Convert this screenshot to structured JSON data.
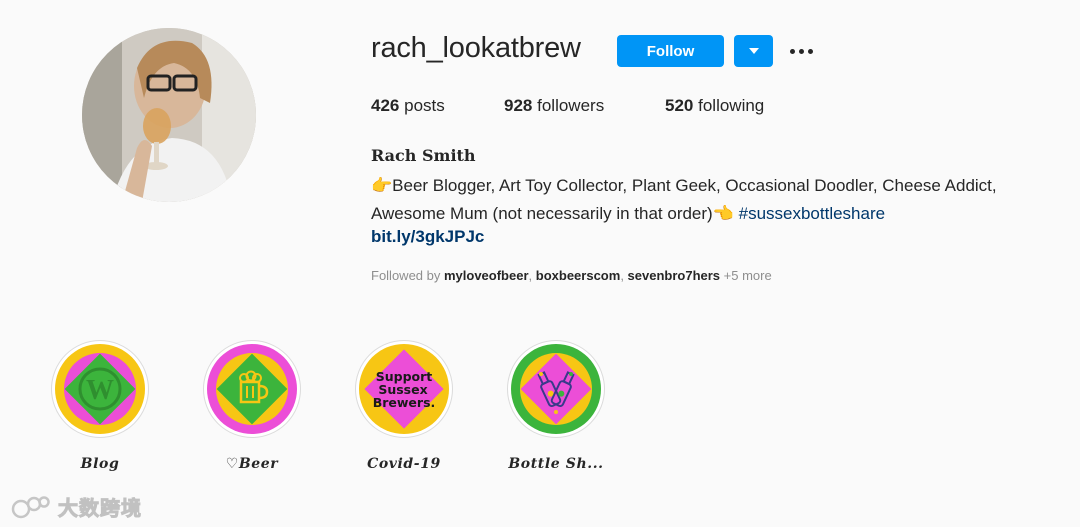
{
  "profile": {
    "username": "rach_lookatbrew",
    "follow_label": "Follow",
    "full_name": "Rach Smith",
    "stats": {
      "posts_count": "426",
      "posts_label": "posts",
      "followers_count": "928",
      "followers_label": "followers",
      "following_count": "520",
      "following_label": "following"
    },
    "bio": {
      "line1": "👉Beer Blogger, Art Toy Collector, Plant Geek, Occasional Doodler, Cheese Addict,",
      "line2": "Awesome Mum (not necessarily in that order)👈 ",
      "hashtag": "#sussexbottleshare"
    },
    "link": "bit.ly/3gkJPJc",
    "followed_by": {
      "prefix": "Followed by ",
      "users": [
        "myloveofbeer",
        "boxbeerscom",
        "sevenbro7hers"
      ],
      "separator": ", ",
      "more": " +5 more"
    }
  },
  "highlights": [
    {
      "label": "Blog",
      "icon": "wordpress-icon"
    },
    {
      "label": "♡Beer",
      "icon": "beer-mug-icon"
    },
    {
      "label": "Covid-19",
      "icon": "support-sussex-brewers-icon",
      "cover_text": [
        "Support",
        "Sussex",
        "Brewers."
      ]
    },
    {
      "label": "Bottle Sh...",
      "icon": "beer-bottles-icon"
    }
  ],
  "watermark": {
    "text": "大数跨境",
    "icon": "logo-icon"
  },
  "colors": {
    "accent_blue": "#0095f6",
    "link_blue": "#00376b",
    "muted_gray": "#8e8e8e",
    "highlight_yellow": "#f7c614",
    "highlight_magenta": "#ec4ed7",
    "highlight_green": "#3cb43c"
  }
}
